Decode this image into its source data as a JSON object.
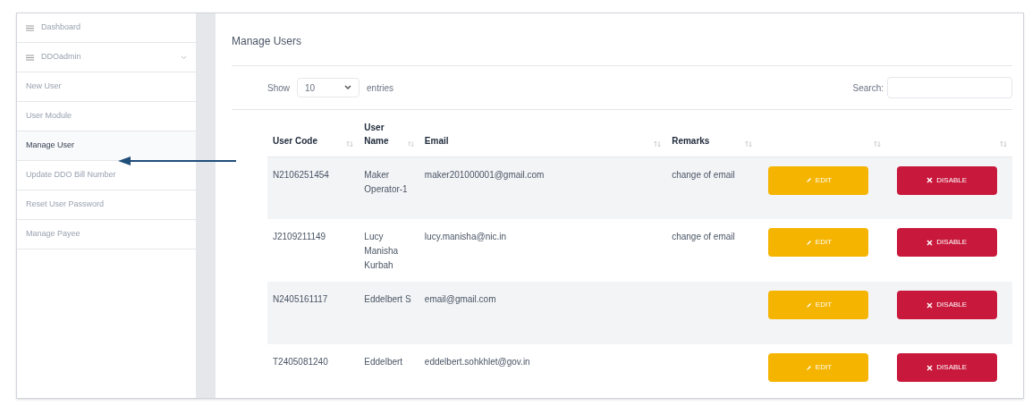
{
  "sidebar": {
    "items": [
      {
        "label": "Dashboard",
        "kind": "icon-item",
        "selected": false
      },
      {
        "label": "DDOadmin",
        "kind": "dropdown",
        "selected": false
      },
      {
        "label": "New User",
        "kind": "link",
        "selected": false
      },
      {
        "label": "User Module",
        "kind": "link",
        "selected": false
      },
      {
        "label": "Manage User",
        "kind": "link",
        "selected": true
      },
      {
        "label": "Update DDO Bill Number",
        "kind": "link",
        "selected": false
      },
      {
        "label": "Reset User Password",
        "kind": "link",
        "selected": false
      },
      {
        "label": "Manage Payee",
        "kind": "link",
        "selected": false
      }
    ]
  },
  "panel": {
    "title": "Manage Users",
    "length_control": {
      "show_label": "Show",
      "value": "10",
      "entries_label": "entries"
    },
    "search": {
      "label": "Search:"
    },
    "table": {
      "columns": [
        "User Code",
        "User Name",
        "Email",
        "Remarks",
        "",
        ""
      ],
      "rows": [
        {
          "user_code": "N2106251454",
          "user_name": "Maker Operator-1",
          "email": "maker201000001@gmail.com",
          "remarks": "change of email",
          "edit": "EDIT",
          "disable": "DISABLE"
        },
        {
          "user_code": "J2109211149",
          "user_name": "Lucy Manisha Kurbah",
          "email": "lucy.manisha@nic.in",
          "remarks": "change of email",
          "edit": "EDIT",
          "disable": "DISABLE"
        },
        {
          "user_code": "N2405161117",
          "user_name": "Eddelbert S",
          "email": "email@gmail.com",
          "remarks": "",
          "edit": "EDIT",
          "disable": "DISABLE"
        },
        {
          "user_code": "T2405081240",
          "user_name": "Eddelbert",
          "email": "eddelbert.sohkhlet@gov.in",
          "remarks": "",
          "edit": "EDIT",
          "disable": "DISABLE"
        }
      ]
    }
  },
  "annotation": {
    "kind": "arrow"
  }
}
